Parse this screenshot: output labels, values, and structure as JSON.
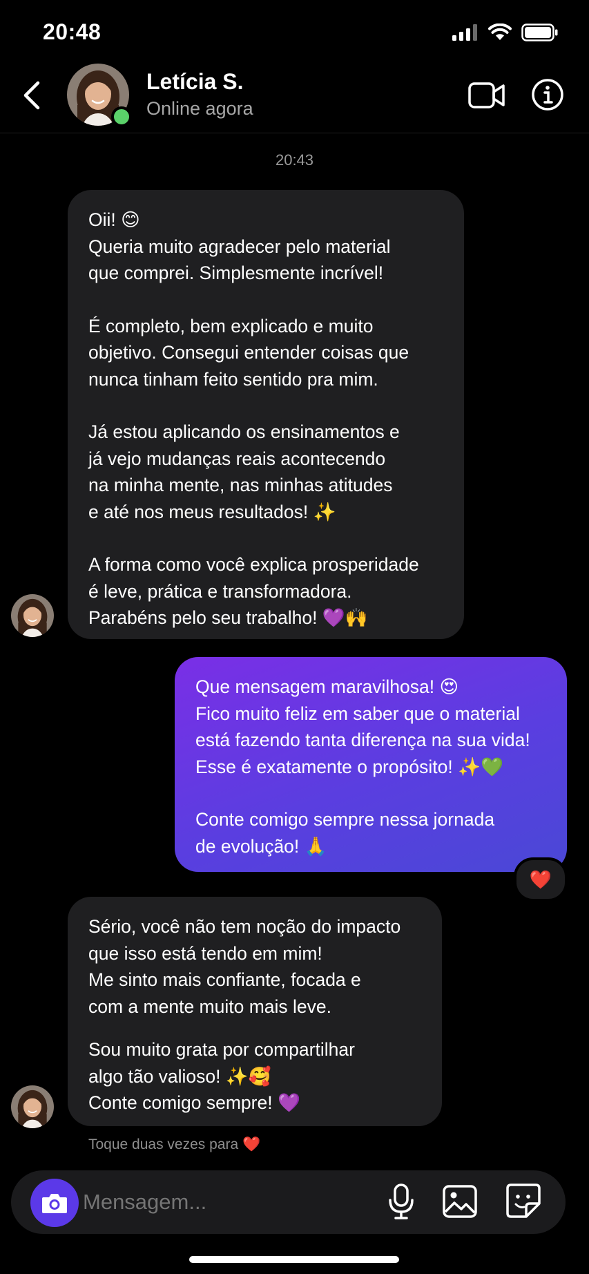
{
  "status": {
    "time": "20:48"
  },
  "header": {
    "name": "Letícia S.",
    "presence": "Online agora"
  },
  "timestamp": "20:43",
  "messages": [
    {
      "from": "them",
      "paragraphs": [
        [
          "Oii! 😊",
          "Queria muito agradecer pelo material",
          "que comprei. Simplesmente incrível!"
        ],
        [
          "É completo, bem explicado e muito",
          "objetivo. Consegui entender coisas que",
          "nunca tinham feito sentido pra mim."
        ],
        [
          "Já estou aplicando os ensinamentos e",
          "já vejo mudanças reais acontecendo",
          "na minha mente, nas minhas atitudes",
          "e até nos meus resultados! ✨"
        ],
        [
          "A forma como você explica prosperidade",
          "é leve, prática e transformadora.",
          "Parabéns pelo seu trabalho! 💜🙌"
        ]
      ]
    },
    {
      "from": "me",
      "reaction": "❤️",
      "paragraphs": [
        [
          "Que mensagem maravilhosa! 😍",
          "Fico muito feliz em saber que o material",
          "está fazendo tanta diferença na sua vida!",
          "Esse é exatamente o propósito! ✨💚"
        ],
        [
          "Conte comigo sempre nessa jornada",
          "de evolução! 🙏"
        ]
      ]
    },
    {
      "from": "them",
      "paragraphs": [
        [
          "Sério, você não tem noção do impacto",
          "que isso está tendo em mim!",
          "Me sinto mais confiante, focada e",
          "com a mente muito mais leve."
        ],
        [
          "Sou muito grata por compartilhar",
          "algo tão valioso! ✨🥰",
          "Conte comigo sempre! 💜"
        ]
      ]
    }
  ],
  "hint": "Toque duas vezes para ❤️",
  "composer": {
    "placeholder": "Mensagem..."
  }
}
